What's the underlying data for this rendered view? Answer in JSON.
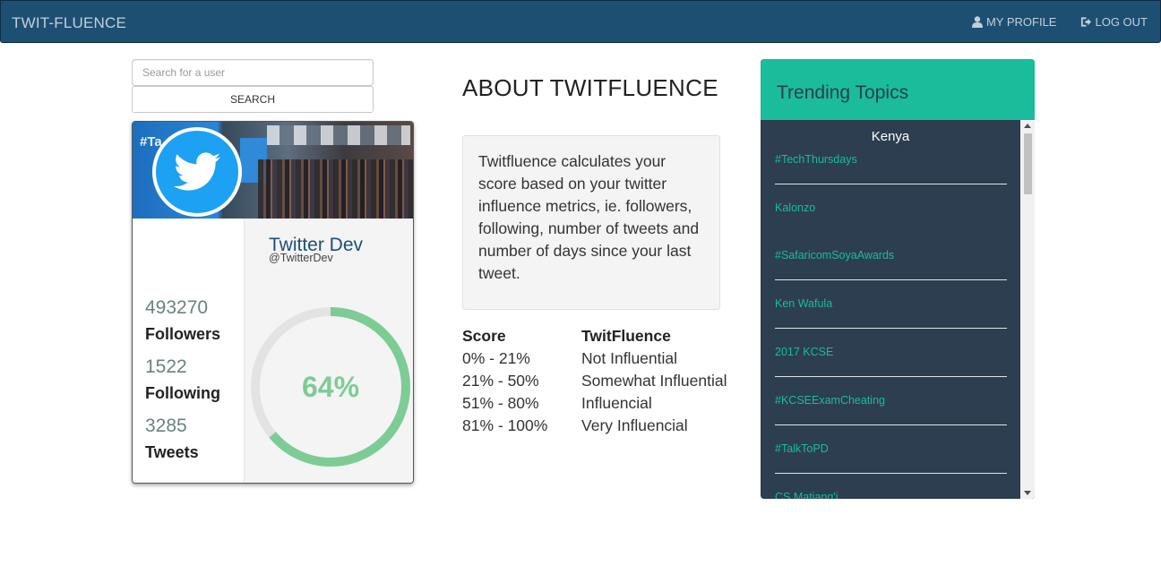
{
  "navbar": {
    "brand": "TWIT-FLUENCE",
    "my_profile": "MY PROFILE",
    "log_out": "LOG OUT"
  },
  "search": {
    "placeholder": "Search for a user",
    "button_label": "SEARCH"
  },
  "profile": {
    "banner_hashtag": "#Ta",
    "name": "Twitter Dev",
    "handle": "@TwitterDev",
    "followers_value": "493270",
    "followers_label": "Followers",
    "following_value": "1522",
    "following_label": "Following",
    "tweets_value": "3285",
    "tweets_label": "Tweets",
    "score_text": "64%",
    "score_fraction": 0.64
  },
  "about": {
    "title": "ABOUT TWITFLUENCE",
    "description": "Twitfluence calculates your score based on your twitter influence metrics, ie. followers, following, number of tweets and number of days since your last tweet."
  },
  "score_table": {
    "headers": [
      "Score",
      "TwitFluence"
    ],
    "rows": [
      [
        "0% - 21%",
        "Not Influential"
      ],
      [
        "21% - 50%",
        "Somewhat Influential"
      ],
      [
        "51% - 80%",
        "Influencial"
      ],
      [
        "81% - 100%",
        "Very Influencial"
      ]
    ]
  },
  "trending": {
    "title": "Trending Topics",
    "country": "Kenya",
    "topics": [
      "#TechThursdays",
      "Kalonzo",
      "#SafaricomSoyaAwards",
      "Ken Wafula",
      "2017 KCSE",
      "#KCSEExamCheating",
      "#TalkToPD",
      "CS Matiang'i"
    ]
  },
  "colors": {
    "navbar": "#1d4f73",
    "accent": "#1abc9c",
    "panel": "#2c3e50",
    "gauge": "#7dcc95",
    "twitter": "#1da1f2"
  }
}
